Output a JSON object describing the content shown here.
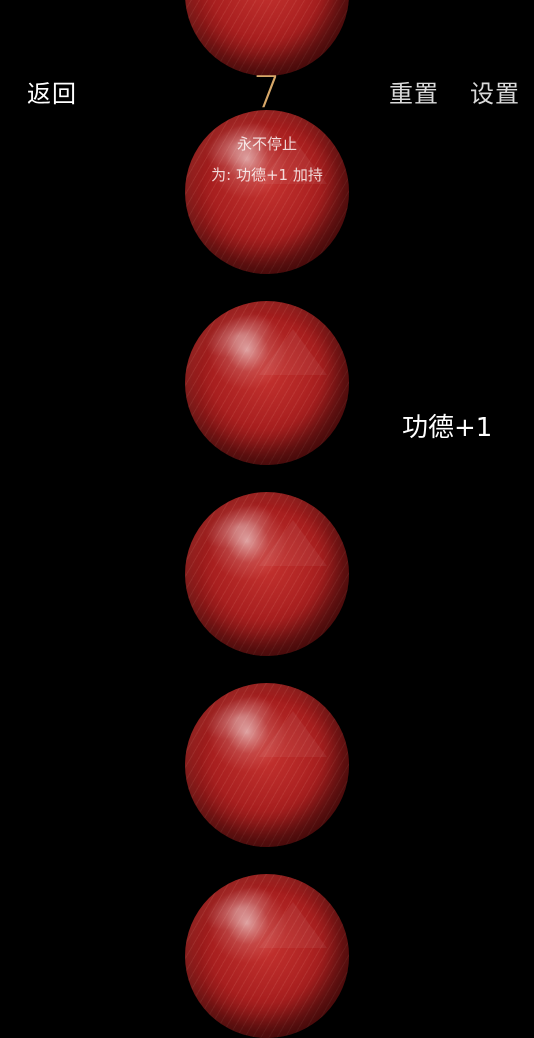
{
  "header": {
    "back_label": "返回",
    "reset_label": "重置",
    "settings_label": "设置"
  },
  "counter": {
    "value": "7"
  },
  "session": {
    "mode_label": "永不停止",
    "dedicate_label": "为: 功德+1 加持"
  },
  "feedback": {
    "merit_text": "功德+1"
  },
  "colors": {
    "background": "#000000",
    "counter": "#d8a869",
    "bead": "#a81f1f"
  },
  "beads": {
    "visible_count": 6
  }
}
